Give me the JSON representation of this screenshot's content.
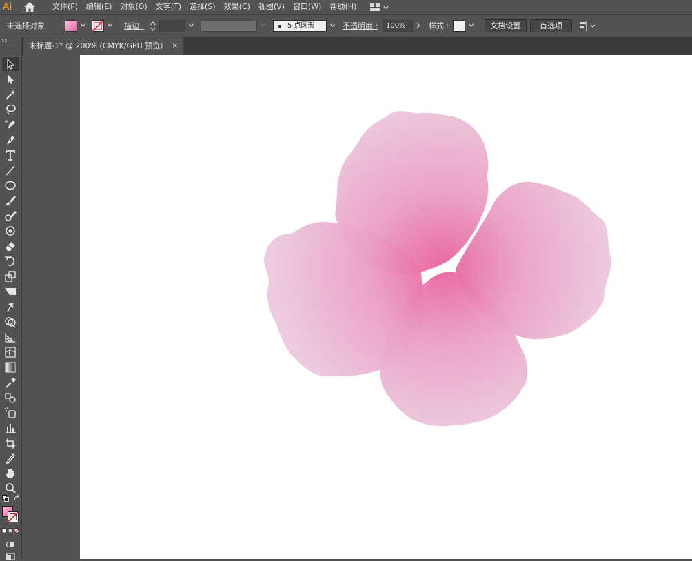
{
  "app": {
    "logo": "Ai"
  },
  "menu": {
    "items": [
      "文件(F)",
      "编辑(E)",
      "对象(O)",
      "文字(T)",
      "选择(S)",
      "效果(C)",
      "视图(V)",
      "窗口(W)",
      "帮助(H)"
    ]
  },
  "control": {
    "selection_status": "未选择对象",
    "stroke_label": "描边 :",
    "brush_value": "5 点圆形",
    "opacity_label": "不透明度 :",
    "opacity_value": "100%",
    "style_label": "样式 :",
    "doc_setup_button": "文档设置",
    "prefs_button": "首选项",
    "colors": {
      "fill": "#f1a9cd",
      "accent_pink": "#e8619f"
    }
  },
  "document": {
    "tab_title": "未标题-1* @ 200% (CMYK/GPU 预览)",
    "close_glyph": "×"
  },
  "tools": [
    "selection-tool",
    "direct-selection-tool",
    "magic-wand-tool",
    "lasso-tool",
    "curvature-pen-tool",
    "pen-tool",
    "type-tool",
    "line-tool",
    "ellipse-tool",
    "paintbrush-tool",
    "blob-brush-tool",
    "shaper-tool",
    "eraser-tool",
    "rotate-tool",
    "scale-tool",
    "width-tool",
    "puppet-warp-tool",
    "shape-builder-tool",
    "perspective-grid-tool",
    "mesh-tool",
    "gradient-tool",
    "eyedropper-tool",
    "blend-tool",
    "symbol-sprayer-tool",
    "column-graph-tool",
    "artboard-tool",
    "slice-tool",
    "hand-tool",
    "zoom-tool"
  ]
}
